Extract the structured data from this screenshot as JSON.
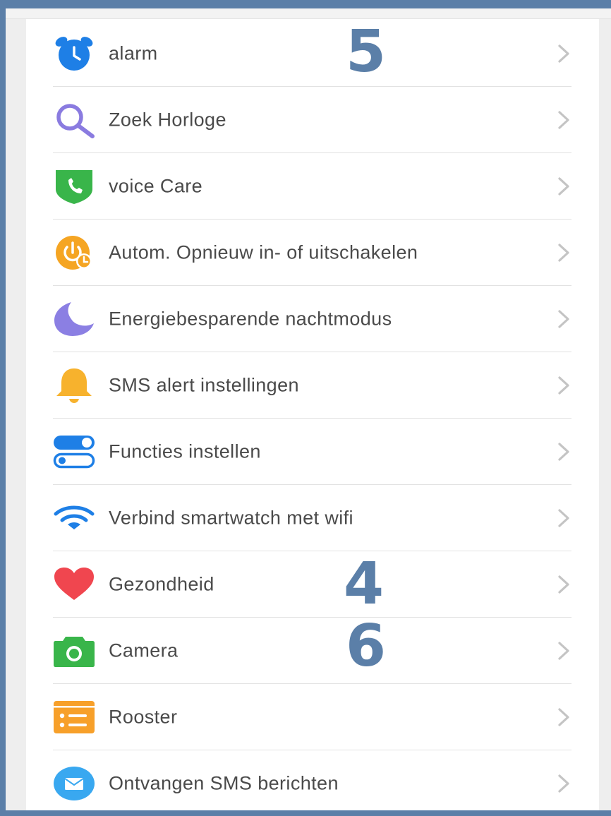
{
  "colors": {
    "background": "#5b7fa8",
    "annotation": "#5b7fa8",
    "text": "#4a4a4a",
    "divider": "#e2e2e2",
    "chevron": "#c4c4c4"
  },
  "settings": {
    "items": [
      {
        "label": "alarm",
        "icon": "alarm-clock-icon",
        "color": "#1e7fe6"
      },
      {
        "label": "Zoek Horloge",
        "icon": "search-icon",
        "color": "#8a7be0"
      },
      {
        "label": "voice Care",
        "icon": "phone-shield-icon",
        "color": "#39b54a"
      },
      {
        "label": "Autom. Opnieuw in- of uitschakelen",
        "icon": "power-clock-icon",
        "color": "#f5a523"
      },
      {
        "label": "Energiebesparende nachtmodus",
        "icon": "moon-icon",
        "color": "#8b7fe3"
      },
      {
        "label": "SMS alert instellingen",
        "icon": "bell-icon",
        "color": "#f7b22d"
      },
      {
        "label": "Functies instellen",
        "icon": "toggle-icon",
        "color": "#1e7fe6"
      },
      {
        "label": "Verbind smartwatch met wifi",
        "icon": "wifi-icon",
        "color": "#1e7fe6"
      },
      {
        "label": "Gezondheid",
        "icon": "heart-icon",
        "color": "#f0464f"
      },
      {
        "label": "Camera",
        "icon": "camera-icon",
        "color": "#39b54a"
      },
      {
        "label": "Rooster",
        "icon": "schedule-icon",
        "color": "#f7a02a"
      },
      {
        "label": "Ontvangen SMS berichten",
        "icon": "envelope-icon",
        "color": "#39a8f0"
      }
    ]
  },
  "annotations": {
    "top": "5",
    "health": "4",
    "camera": "6"
  }
}
